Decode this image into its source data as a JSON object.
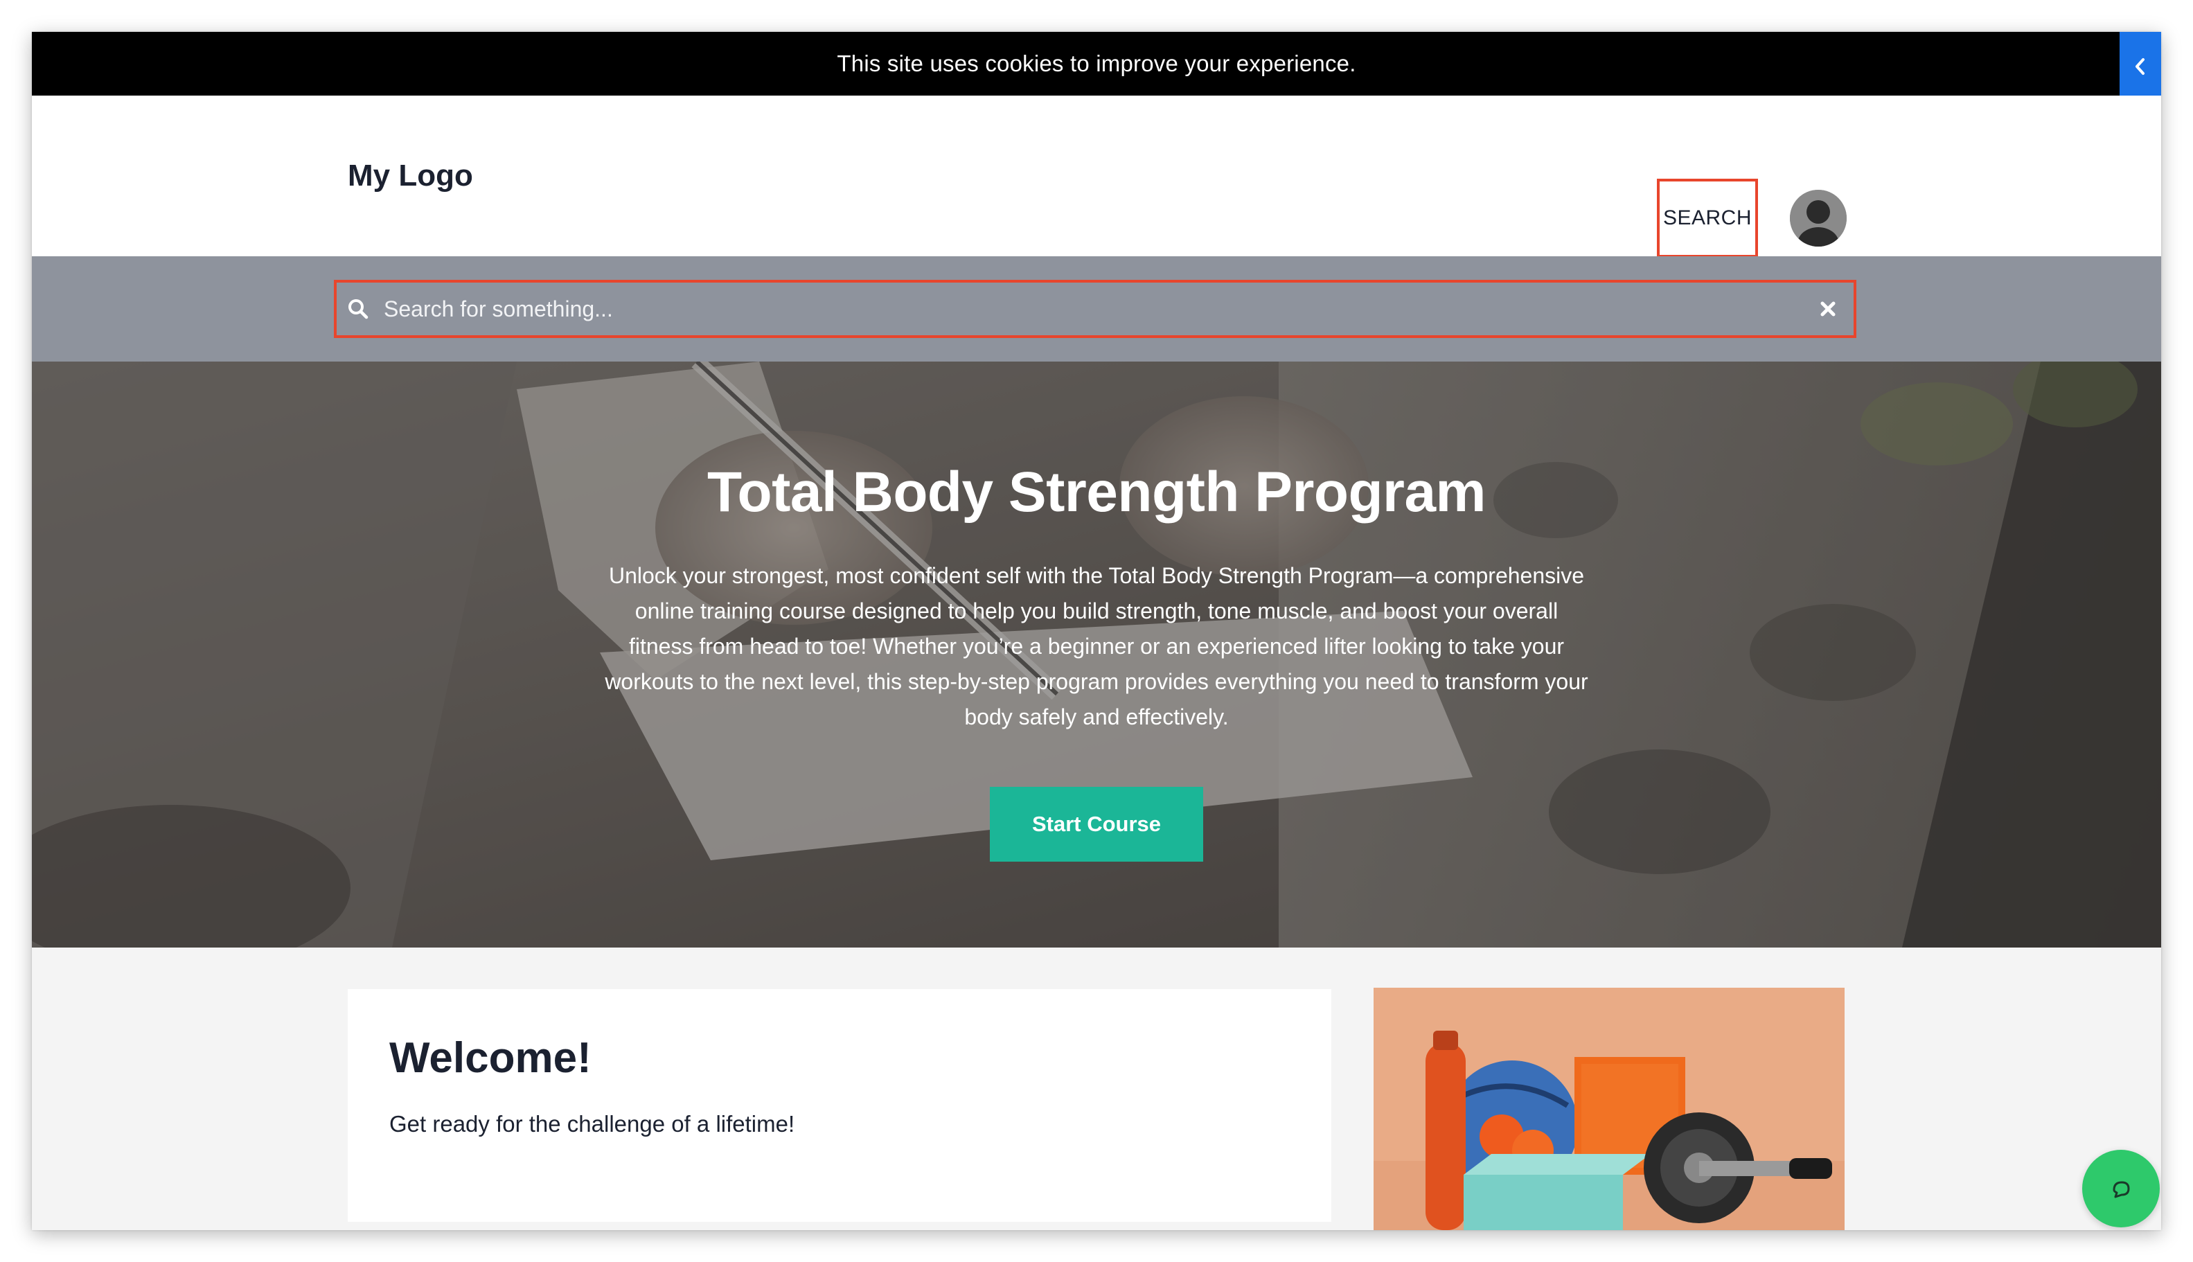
{
  "cookie_bar": {
    "message": "This site uses cookies to improve your experience."
  },
  "side_toggle": {
    "icon": "chevron-left-icon",
    "color": "#1a73e8"
  },
  "header": {
    "logo": "My Logo",
    "search_label": "SEARCH",
    "avatar_icon": "user-avatar-icon"
  },
  "search": {
    "placeholder": "Search for something...",
    "value": "",
    "search_icon": "search-icon",
    "clear_icon": "close-icon",
    "highlight_color": "#e8452c"
  },
  "hero": {
    "title": "Total Body Strength Program",
    "description": "Unlock your strongest, most confident self with the Total Body Strength Program—a comprehensive online training course designed to help you build strength, tone muscle, and boost your overall fitness from head to toe! Whether you’re a beginner or an experienced lifter looking to take your workouts to the next level, this step-by-step program provides everything you need to transform your body safely and effectively.",
    "button_label": "Start Course",
    "button_color": "#1bb697"
  },
  "welcome": {
    "title": "Welcome!",
    "text": "Get ready for the challenge of a lifetime!"
  },
  "chat": {
    "icon": "chat-bubble-icon",
    "color": "#2ec96b"
  }
}
